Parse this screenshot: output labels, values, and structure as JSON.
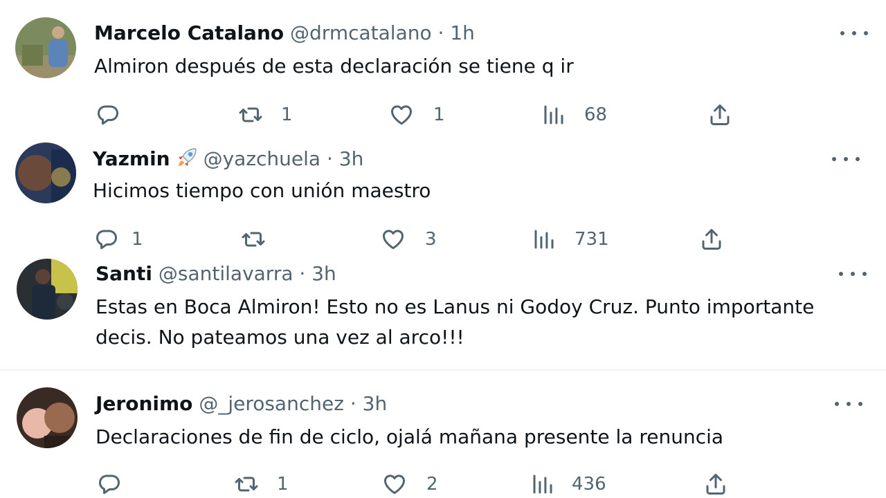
{
  "tweets": [
    {
      "name": "Marcelo Catalano",
      "handle": "@drmcatalano",
      "sep": "·",
      "time": "1h",
      "text": "Almiron después de esta declaración se tiene q ir",
      "replies": "",
      "retweets": "1",
      "likes": "1",
      "views": "68"
    },
    {
      "name": "Yazmin",
      "emoji": "rocket",
      "handle": "@yazchuela",
      "sep": "·",
      "time": "3h",
      "text": "Hicimos tiempo con unión maestro",
      "replies": "1",
      "retweets": "",
      "likes": "3",
      "views": "731"
    },
    {
      "name": "Santi",
      "handle": "@santilavarra",
      "sep": "·",
      "time": "3h",
      "text_line1": "Estas en Boca Almiron! Esto no es Lanus ni Godoy Cruz. Punto importante",
      "text_line2": "decis. No pateamos una vez al arco!!!"
    },
    {
      "name": "Jeronimo",
      "handle": "@_jerosanchez",
      "sep": "·",
      "time": "3h",
      "text": "Declaraciones de fin de ciclo, ojalá mañana presente la renuncia",
      "replies": "",
      "retweets": "1",
      "likes": "2",
      "views": "436"
    }
  ],
  "icons": {
    "reply": "reply-icon",
    "retweet": "retweet-icon",
    "like": "heart-icon",
    "views": "views-icon",
    "share": "share-icon",
    "more": "more-icon"
  },
  "colors": {
    "text": "#0f1419",
    "secondary": "#536471",
    "divider": "#eff3f4"
  }
}
